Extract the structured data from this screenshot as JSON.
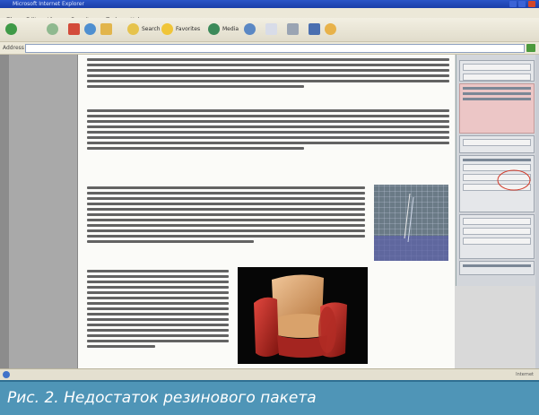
{
  "window": {
    "title": "Microsoft Internet Explorer"
  },
  "menu": [
    "File",
    "Edit",
    "View",
    "Favorites",
    "Tools",
    "Help"
  ],
  "toolbar": {
    "search_label": "Search",
    "favorites_label": "Favorites",
    "media_label": "Media"
  },
  "address": {
    "label": "Address"
  },
  "status": {
    "zone_label": "Internet"
  },
  "caption": {
    "text": "Рис. 2. Недостаток резинового пакета"
  },
  "colors": {
    "caption_bg": "#4f95b7",
    "titlebar": "#1a3ea8",
    "render_bg": "#060606",
    "chair_body": "#c5312c",
    "chair_cushion": "#d9a26b"
  }
}
